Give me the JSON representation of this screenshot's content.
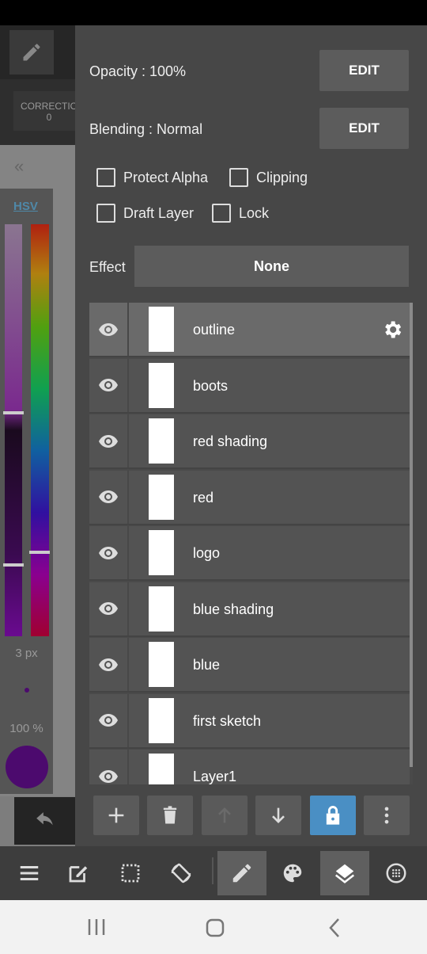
{
  "left": {
    "correction_label": "CORRECTIO",
    "correction_value": "0",
    "color_mode": "HSV",
    "brush_size": "3 px",
    "brush_opacity": "100 %",
    "brush_color": "#4c0a6e"
  },
  "panel": {
    "opacity_label": "Opacity : 100%",
    "blending_label": "Blending : Normal",
    "edit_label": "EDIT",
    "checkboxes": [
      {
        "label": "Protect Alpha",
        "checked": false
      },
      {
        "label": "Clipping",
        "checked": false
      },
      {
        "label": "Draft Layer",
        "checked": false
      },
      {
        "label": "Lock",
        "checked": false
      }
    ],
    "effect_label": "Effect",
    "effect_value": "None"
  },
  "layers": [
    {
      "name": "outline",
      "selected": true
    },
    {
      "name": "boots"
    },
    {
      "name": "red shading"
    },
    {
      "name": "red"
    },
    {
      "name": "logo"
    },
    {
      "name": "blue shading"
    },
    {
      "name": "blue"
    },
    {
      "name": "first sketch"
    },
    {
      "name": "Layer1"
    }
  ],
  "layer_actions": [
    "add-icon",
    "trash-icon",
    "move-up-icon",
    "move-down-icon",
    "lock-icon",
    "more-vertical-icon"
  ],
  "toolbar": [
    "menu-icon",
    "edit-icon",
    "selection-icon",
    "rotate-icon",
    "pencil-icon",
    "palette-icon",
    "layers-icon",
    "grid-icon"
  ],
  "colors": {
    "accent": "#4a8fc4"
  }
}
